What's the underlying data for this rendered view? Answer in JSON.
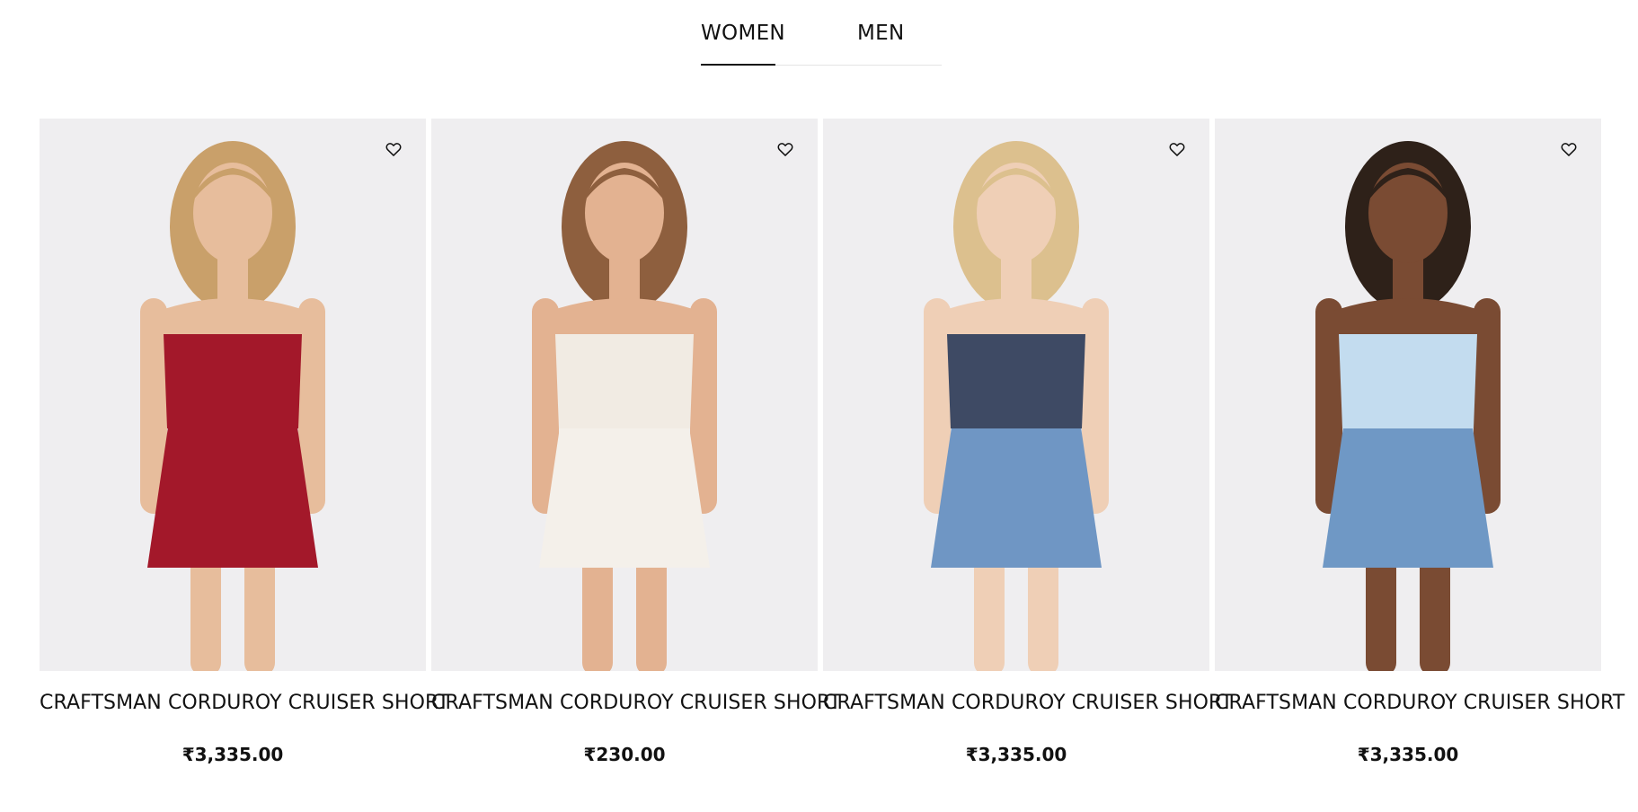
{
  "tabs": [
    {
      "label": "WOMEN",
      "active": true
    },
    {
      "label": "MEN",
      "active": false
    }
  ],
  "products": [
    {
      "title": "CRAFTSMAN CORDUROY CRUISER SHORT",
      "price": "₹3,335.00",
      "wishlist_icon": "heart-outline-icon",
      "image": {
        "hair": "#c9a06a",
        "skin": "#e7bd9c",
        "top": "#a3182a",
        "bottom": "#a3182a",
        "outfit": "red ruched strapless mini dress"
      }
    },
    {
      "title": "CRAFTSMAN CORDUROY CRUISER SHORT",
      "price": "₹230.00",
      "wishlist_icon": "heart-outline-icon",
      "image": {
        "hair": "#8e5f3e",
        "skin": "#e3b291",
        "top": "#f1ebe3",
        "bottom": "#f4f0ea",
        "outfit": "white smocked ruffle mini dress"
      }
    },
    {
      "title": "CRAFTSMAN CORDUROY CRUISER SHORT",
      "price": "₹3,335.00",
      "wishlist_icon": "heart-outline-icon",
      "image": {
        "hair": "#dcc08e",
        "skin": "#efcfb6",
        "top": "#3e4a64",
        "bottom": "#6f96c4",
        "outfit": "striped crop top with denim shorts"
      }
    },
    {
      "title": "CRAFTSMAN CORDUROY CRUISER SHORT",
      "price": "₹3,335.00",
      "wishlist_icon": "heart-outline-icon",
      "image": {
        "hair": "#2e2119",
        "skin": "#7a4b33",
        "top": "#c3dcef",
        "bottom": "#6f98c5",
        "outfit": "light blue blouse with denim shorts"
      }
    }
  ],
  "colors": {
    "text": "#111111",
    "image_background": "#f0eff1",
    "tab_rule": "#e4e4e4"
  }
}
